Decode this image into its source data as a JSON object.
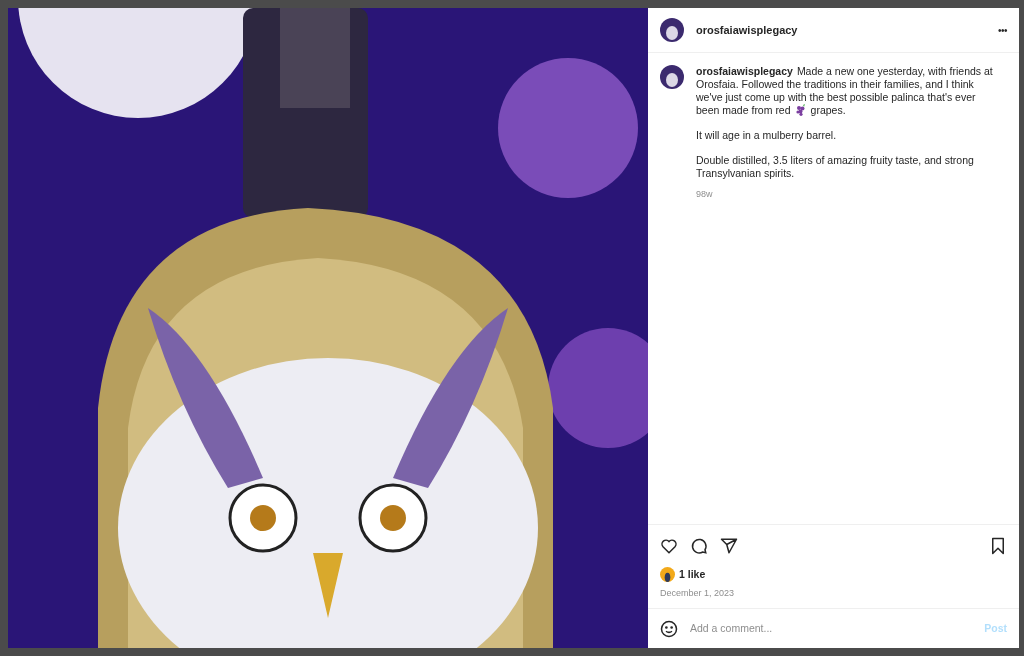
{
  "post": {
    "header": {
      "username": "orosfaiawisplegacy",
      "menu": "•••"
    },
    "caption": {
      "username": "orosfaiawisplegacy",
      "lead": "Made a new one yesterday, with friends at Orosfaia. Followed the traditions in their families, and I think we've just come up with the best possible palinca that's ever been made from red",
      "trail": "grapes.",
      "paragraphs": [
        "It will age in a mulberry barrel.",
        "Double distilled, 3.5 liters of amazing fruity taste, and strong Transylvanian spirits."
      ],
      "age": "98w"
    },
    "actions": {
      "liked": false,
      "saved": false
    },
    "likes": "1 like",
    "date": "December 1, 2023",
    "comment": {
      "placeholder": "Add a comment...",
      "post_label": "Post"
    }
  }
}
